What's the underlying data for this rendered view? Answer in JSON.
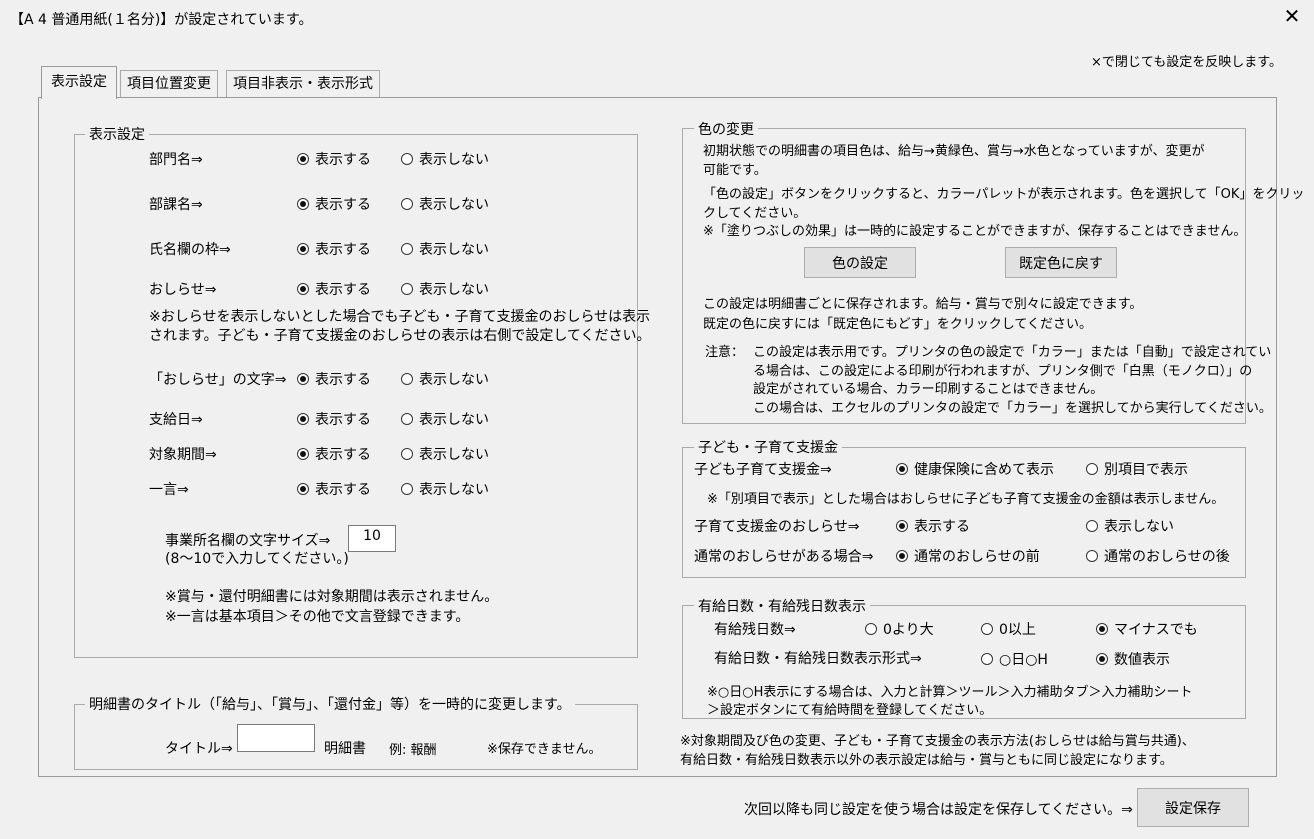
{
  "window": {
    "title": "【A 4 普通用紙(１名分)】が設定されています。",
    "close_glyph": "✕",
    "hint": "×で閉じても設定を反映します。"
  },
  "tabs": [
    {
      "label": "表示設定",
      "active": true
    },
    {
      "label": "項目位置変更",
      "active": false
    },
    {
      "label": "項目非表示・表示形式",
      "active": false
    }
  ],
  "display": {
    "group_title": "表示設定",
    "opt_show": "表示する",
    "opt_hide": "表示しない",
    "rows": [
      {
        "label": "部門名⇒",
        "selected": "show"
      },
      {
        "label": "部課名⇒",
        "selected": "show"
      },
      {
        "label": "氏名欄の枠⇒",
        "selected": "show"
      },
      {
        "label": "おしらせ⇒",
        "selected": "show"
      },
      {
        "label": "「おしらせ」の文字⇒",
        "selected": "show"
      },
      {
        "label": "支給日⇒",
        "selected": "show"
      },
      {
        "label": "対象期間⇒",
        "selected": "show"
      },
      {
        "label": "一言⇒",
        "selected": "show"
      }
    ],
    "note_oshirase_1": "※おしらせを表示しないとした場合でも子ども・子育て支援金のおしらせは表示",
    "note_oshirase_2": "されます。子ども・子育て支援金のおしらせの表示は右側で設定してください。",
    "fontsize_label": "事業所名欄の文字サイズ⇒",
    "fontsize_value": "10",
    "fontsize_hint": "(8～10で入力してください。)",
    "note_bonus": "※賞与・還付明細書には対象期間は表示されません。",
    "note_hitokoto": "※一言は基本項目＞その他で文言登録できます。"
  },
  "title_change": {
    "group_title": "明細書のタイトル（「給与」、「賞与」、「還付金」等）を一時的に変更します。",
    "label": "タイトル⇒",
    "value": "",
    "suffix": "明細書",
    "example": "例:  報酬",
    "note": "※保存できません。"
  },
  "color": {
    "group_title": "色の変更",
    "desc1": "初期状態での明細書の項目色は、給与→黄緑色、賞与→水色となっていますが、変更が",
    "desc2": "可能です。",
    "desc3": "「色の設定」ボタンをクリックすると、カラーパレットが表示されます。色を選択して「OK」をクリッ",
    "desc4": "クしてください。",
    "desc5": "※「塗りつぶしの効果」は一時的に設定することができますが、保存することはできません。",
    "btn_set": "色の設定",
    "btn_reset": "既定色に戻す",
    "desc6": "この設定は明細書ごとに保存されます。給与・賞与で別々に設定できます。",
    "desc7": "既定の色に戻すには「既定色にもどす」をクリックしてください。",
    "caution_label": "注意：",
    "caution1": "この設定は表示用です。プリンタの色の設定で「カラー」または「自動」で設定されてい",
    "caution2": "る場合は、この設定による印刷が行われますが、プリンタ側で「白黒（モノクロ）」の",
    "caution3": "設定がされている場合、カラー印刷することはできません。",
    "caution4": "この場合は、エクセルのプリンタの設定で「カラー」を選択してから実行してください。"
  },
  "child_support": {
    "group_title": "子ども・子育て支援金",
    "row1_label": "子ども子育て支援金⇒",
    "row1_opt1": "健康保険に含めて表示",
    "row1_opt2": "別項目で表示",
    "row1_selected": 1,
    "note": "※「別項目で表示」とした場合はおしらせに子ども子育て支援金の金額は表示しません。",
    "row2_label": "子育て支援金のおしらせ⇒",
    "row2_opt1": "表示する",
    "row2_opt2": "表示しない",
    "row2_selected": 1,
    "row3_label": "通常のおしらせがある場合⇒",
    "row3_opt1": "通常のおしらせの前",
    "row3_opt2": "通常のおしらせの後",
    "row3_selected": 1,
    "highlight_color": "#d40000"
  },
  "paid_leave": {
    "group_title": "有給日数・有給残日数表示",
    "row1_label": "有給残日数⇒",
    "row1_opt1": "0より大",
    "row1_opt2": "0以上",
    "row1_opt3": "マイナスでも",
    "row1_selected": 3,
    "row2_label": "有給日数・有給残日数表示形式⇒",
    "row2_opt1": "○日○H",
    "row2_opt2": "数値表示",
    "row2_selected": 2,
    "note1": "※○日○H表示にする場合は、入力と計算＞ツール＞入力補助タブ＞入力補助シート",
    "note2": "＞設定ボタンにて有給時間を登録してください。"
  },
  "footer": {
    "note1": "※対象期間及び色の変更、子ども・子育て支援金の表示方法(おしらせは給与賞与共通)、",
    "note2": "有給日数・有給残日数表示以外の表示設定は給与・賞与ともに同じ設定になります。",
    "save_hint": "次回以降も同じ設定を使う場合は設定を保存してください。⇒",
    "save_button": "設定保存"
  }
}
